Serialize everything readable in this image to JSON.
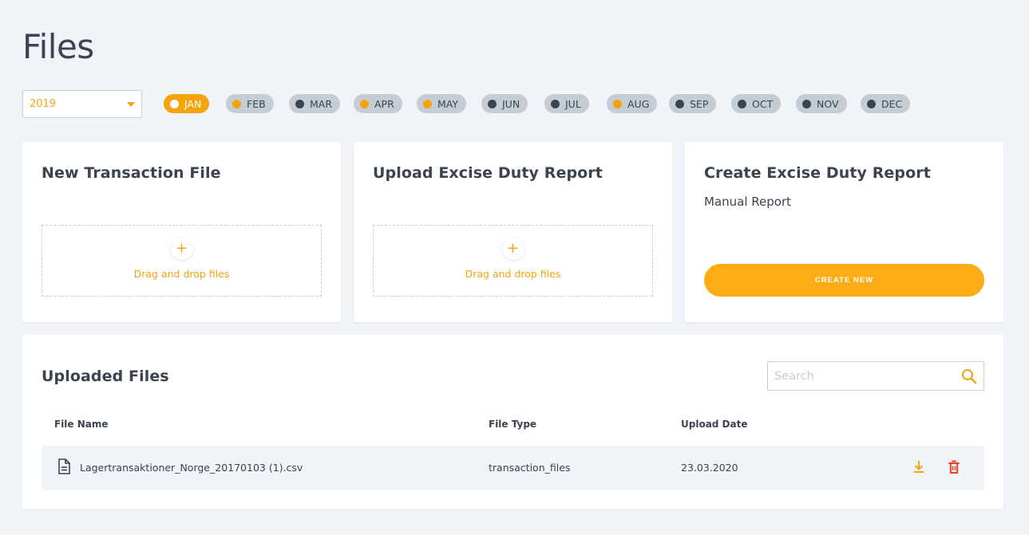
{
  "page": {
    "title": "Files"
  },
  "filters": {
    "year": "2019",
    "months": [
      {
        "label": "JAN",
        "state": "active"
      },
      {
        "label": "FEB",
        "state": "has-data"
      },
      {
        "label": "MAR",
        "state": "empty"
      },
      {
        "label": "APR",
        "state": "has-data"
      },
      {
        "label": "MAY",
        "state": "has-data"
      },
      {
        "label": "JUN",
        "state": "empty"
      },
      {
        "label": "JUL",
        "state": "empty"
      },
      {
        "label": "AUG",
        "state": "has-data"
      },
      {
        "label": "SEP",
        "state": "empty"
      },
      {
        "label": "OCT",
        "state": "empty"
      },
      {
        "label": "NOV",
        "state": "empty"
      },
      {
        "label": "DEC",
        "state": "empty"
      }
    ]
  },
  "cards": {
    "new_transaction": {
      "title": "New Transaction File",
      "dropzone_label": "Drag and drop files"
    },
    "upload_report": {
      "title": "Upload Excise Duty Report",
      "dropzone_label": "Drag and drop files"
    },
    "create_report": {
      "title": "Create Excise Duty Report",
      "subtitle": "Manual Report",
      "button_label": "CREATE NEW"
    }
  },
  "uploaded": {
    "title": "Uploaded Files",
    "search_placeholder": "Search",
    "columns": {
      "name": "File Name",
      "type": "File Type",
      "date": "Upload Date"
    },
    "rows": [
      {
        "name": "Lagertransaktioner_Norge_20170103 (1).csv",
        "type": "transaction_files",
        "date": "23.03.2020"
      }
    ]
  },
  "colors": {
    "accent": "#f5a30c",
    "danger": "#e8412b",
    "text": "#3b4351",
    "chip": "#c4ccd4"
  },
  "icons": {
    "upload": "plus-icon",
    "search": "search-icon",
    "file": "file-icon",
    "download": "download-icon",
    "delete": "trash-icon"
  }
}
